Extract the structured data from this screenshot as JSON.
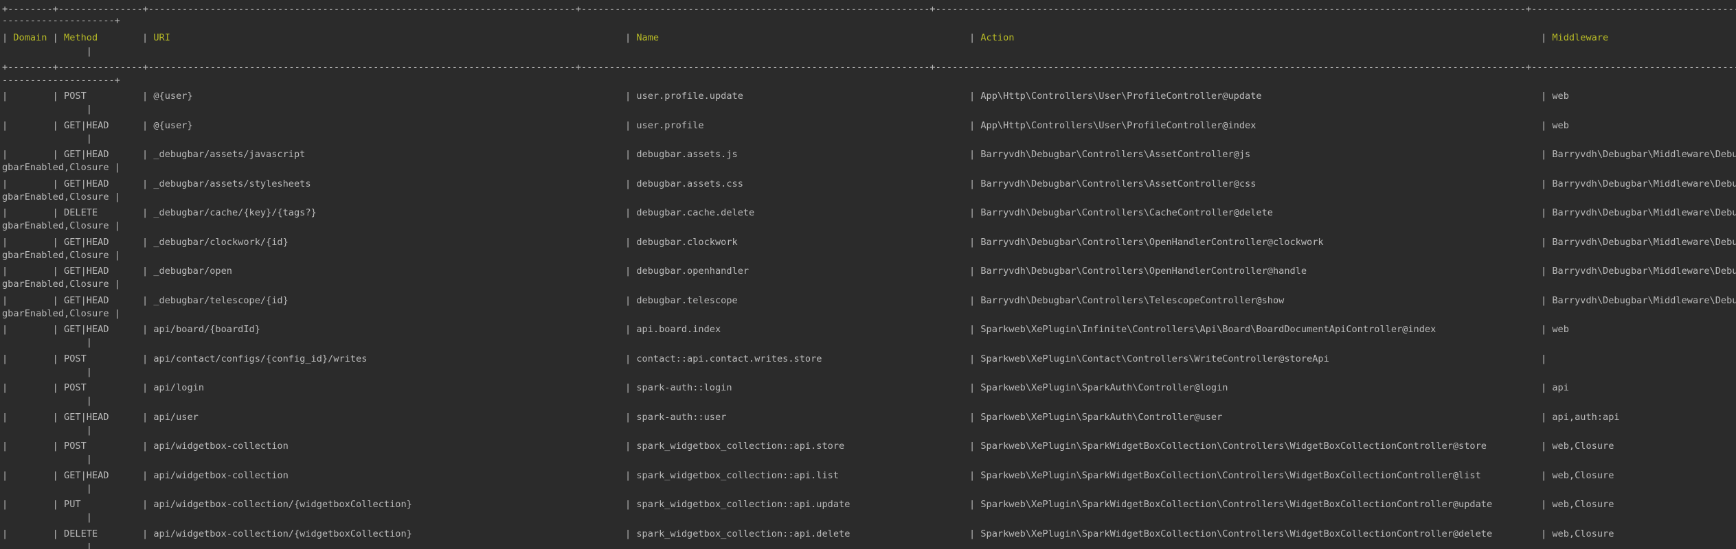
{
  "terminal": {
    "border_rule": "+--------+---------------+----------------------------------------------------------------------------+--------------------------------------------------------------+---------------------------------------------------------------------------------------------------------+---------------------------------------------------------------------------------------------------------------------------",
    "border_wrap": "--------------------+",
    "continuation_pipe": "               |",
    "headers": {
      "domain": "Domain",
      "method": "Method",
      "uri": "URI",
      "name": "Name",
      "action": "Action",
      "middleware": "Middleware"
    },
    "rows": [
      {
        "method": "POST",
        "uri": "@{user}",
        "name": "user.profile.update",
        "action": "App\\Http\\Controllers\\User\\ProfileController@update",
        "middleware": "web",
        "wrap": "               |"
      },
      {
        "method": "GET|HEAD",
        "uri": "@{user}",
        "name": "user.profile",
        "action": "App\\Http\\Controllers\\User\\ProfileController@index",
        "middleware": "web",
        "wrap": "               |"
      },
      {
        "method": "GET|HEAD",
        "uri": "_debugbar/assets/javascript",
        "name": "debugbar.assets.js",
        "action": "Barryvdh\\Debugbar\\Controllers\\AssetController@js",
        "middleware": "Barryvdh\\Debugbar\\Middleware\\Debu",
        "wrap": "gbarEnabled,Closure |"
      },
      {
        "method": "GET|HEAD",
        "uri": "_debugbar/assets/stylesheets",
        "name": "debugbar.assets.css",
        "action": "Barryvdh\\Debugbar\\Controllers\\AssetController@css",
        "middleware": "Barryvdh\\Debugbar\\Middleware\\Debu",
        "wrap": "gbarEnabled,Closure |"
      },
      {
        "method": "DELETE",
        "uri": "_debugbar/cache/{key}/{tags?}",
        "name": "debugbar.cache.delete",
        "action": "Barryvdh\\Debugbar\\Controllers\\CacheController@delete",
        "middleware": "Barryvdh\\Debugbar\\Middleware\\Debu",
        "wrap": "gbarEnabled,Closure |"
      },
      {
        "method": "GET|HEAD",
        "uri": "_debugbar/clockwork/{id}",
        "name": "debugbar.clockwork",
        "action": "Barryvdh\\Debugbar\\Controllers\\OpenHandlerController@clockwork",
        "middleware": "Barryvdh\\Debugbar\\Middleware\\Debu",
        "wrap": "gbarEnabled,Closure |"
      },
      {
        "method": "GET|HEAD",
        "uri": "_debugbar/open",
        "name": "debugbar.openhandler",
        "action": "Barryvdh\\Debugbar\\Controllers\\OpenHandlerController@handle",
        "middleware": "Barryvdh\\Debugbar\\Middleware\\Debu",
        "wrap": "gbarEnabled,Closure |"
      },
      {
        "method": "GET|HEAD",
        "uri": "_debugbar/telescope/{id}",
        "name": "debugbar.telescope",
        "action": "Barryvdh\\Debugbar\\Controllers\\TelescopeController@show",
        "middleware": "Barryvdh\\Debugbar\\Middleware\\Debu",
        "wrap": "gbarEnabled,Closure |"
      },
      {
        "method": "GET|HEAD",
        "uri": "api/board/{boardId}",
        "name": "api.board.index",
        "action": "Sparkweb\\XePlugin\\Infinite\\Controllers\\Api\\Board\\BoardDocumentApiController@index",
        "middleware": "web",
        "wrap": "               |"
      },
      {
        "method": "POST",
        "uri": "api/contact/configs/{config_id}/writes",
        "name": "contact::api.contact.writes.store",
        "action": "Sparkweb\\XePlugin\\Contact\\Controllers\\WriteController@storeApi",
        "middleware": "",
        "wrap": "               |"
      },
      {
        "method": "POST",
        "uri": "api/login",
        "name": "spark-auth::login",
        "action": "Sparkweb\\XePlugin\\SparkAuth\\Controller@login",
        "middleware": "api",
        "wrap": "               |"
      },
      {
        "method": "GET|HEAD",
        "uri": "api/user",
        "name": "spark-auth::user",
        "action": "Sparkweb\\XePlugin\\SparkAuth\\Controller@user",
        "middleware": "api,auth:api",
        "wrap": "               |"
      },
      {
        "method": "POST",
        "uri": "api/widgetbox-collection",
        "name": "spark_widgetbox_collection::api.store",
        "action": "Sparkweb\\XePlugin\\SparkWidgetBoxCollection\\Controllers\\WidgetBoxCollectionController@store",
        "middleware": "web,Closure",
        "wrap": "               |"
      },
      {
        "method": "GET|HEAD",
        "uri": "api/widgetbox-collection",
        "name": "spark_widgetbox_collection::api.list",
        "action": "Sparkweb\\XePlugin\\SparkWidgetBoxCollection\\Controllers\\WidgetBoxCollectionController@list",
        "middleware": "web,Closure",
        "wrap": "               |"
      },
      {
        "method": "PUT",
        "uri": "api/widgetbox-collection/{widgetboxCollection}",
        "name": "spark_widgetbox_collection::api.update",
        "action": "Sparkweb\\XePlugin\\SparkWidgetBoxCollection\\Controllers\\WidgetBoxCollectionController@update",
        "middleware": "web,Closure",
        "wrap": "               |"
      },
      {
        "method": "DELETE",
        "uri": "api/widgetbox-collection/{widgetboxCollection}",
        "name": "spark_widgetbox_collection::api.delete",
        "action": "Sparkweb\\XePlugin\\SparkWidgetBoxCollection\\Controllers\\WidgetBoxCollectionController@delete",
        "middleware": "web,Closure",
        "wrap": "               |"
      }
    ]
  }
}
